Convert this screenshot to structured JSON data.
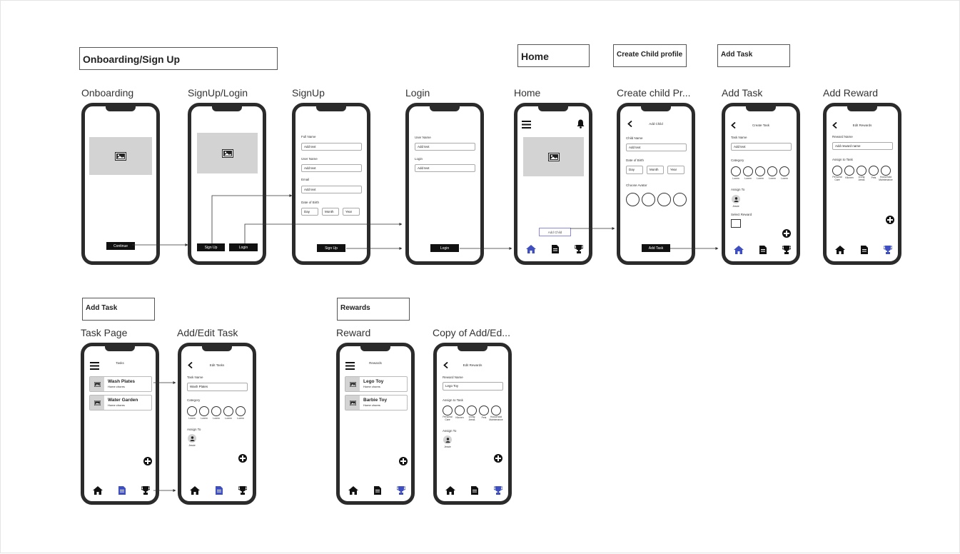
{
  "sections": {
    "onboarding": "Onboarding/Sign Up",
    "home": "Home",
    "create_child": "Create Child profile",
    "add_task": "Add Task",
    "add_task_2": "Add Task",
    "rewards": "Rewards"
  },
  "frames": {
    "onboarding": {
      "label": "Onboarding",
      "continue": "Continue"
    },
    "signup_login": {
      "label": "SignUp/Login",
      "signup": "Sign Up",
      "login": "Login"
    },
    "signup": {
      "label": "SignUp",
      "full_name": "Full Name",
      "user_name": "User Name",
      "email": "Email",
      "dob": "Date of Birth",
      "add_text": "Add text",
      "day": "Day",
      "month": "Month",
      "year": "Year",
      "button": "Sign Up"
    },
    "login": {
      "label": "Login",
      "user_name": "User Name",
      "login_label": "Login",
      "add_text": "Add text",
      "button": "Login"
    },
    "home": {
      "label": "Home",
      "add_child": "Add Child"
    },
    "create_child": {
      "label": "Create child Pr...",
      "title": "Add Child",
      "child_name": "Child Name",
      "add_text": "Add text",
      "dob": "Date of Birth",
      "day": "Day",
      "month": "Month",
      "year": "Year",
      "choose_avatar": "Choose Avatar",
      "button": "Add Task"
    },
    "add_task": {
      "label": "Add Task",
      "title": "Create Task",
      "task_name": "Task Name",
      "add_text": "Add text",
      "category": "Category",
      "cats": [
        "Lorem",
        "Lorem",
        "Lorem",
        "Lorem",
        "Lorem"
      ],
      "assign_to": "Assign To",
      "avatar_name": "Jessie",
      "select_reward": "Select Reward"
    },
    "add_reward": {
      "label": "Add Reward",
      "title": "Edit Rewards",
      "reward_name": "Reward Name",
      "placeholder": "Add reward name",
      "assign_to_task": "Assign to Task",
      "cats": [
        "Personal Care",
        "Kitchen",
        "Living Areas",
        "Pets",
        "Household Maintenance"
      ]
    },
    "task_page": {
      "label": "Task Page",
      "title": "Tasks",
      "items": [
        {
          "name": "Wash Plates",
          "sub": "Home chores"
        },
        {
          "name": "Water Garden",
          "sub": "Home chores"
        }
      ]
    },
    "edit_task": {
      "label": "Add/Edit Task",
      "title": "Edit Tasks",
      "task_name": "Task Name",
      "value": "Wash Plates",
      "category": "Category",
      "cats": [
        "Lorem",
        "Lorem",
        "Lorem",
        "Lorem",
        "Lorem"
      ],
      "assign_to": "Assign To",
      "avatar_name": "Jessie"
    },
    "reward": {
      "label": "Reward",
      "title": "Rewards",
      "items": [
        {
          "name": "Lego Toy",
          "sub": "Home chores"
        },
        {
          "name": "Barbie Toy",
          "sub": "Home chores"
        }
      ]
    },
    "copy_edit": {
      "label": "Copy of Add/Ed...",
      "title": "Edit Rewards",
      "reward_name": "Reward Name",
      "value": "Lego Toy",
      "assign_to_task": "Assign to Task",
      "cats": [
        "Personal Care",
        "Kitchen",
        "Living Areas",
        "Pets",
        "Household Maintenance"
      ],
      "assign_to": "Assign To",
      "avatar_name": "Jessie"
    }
  },
  "colors": {
    "accent": "#3f4fbf",
    "frame": "#2b2b2b",
    "placeholder": "#d3d3d3"
  }
}
